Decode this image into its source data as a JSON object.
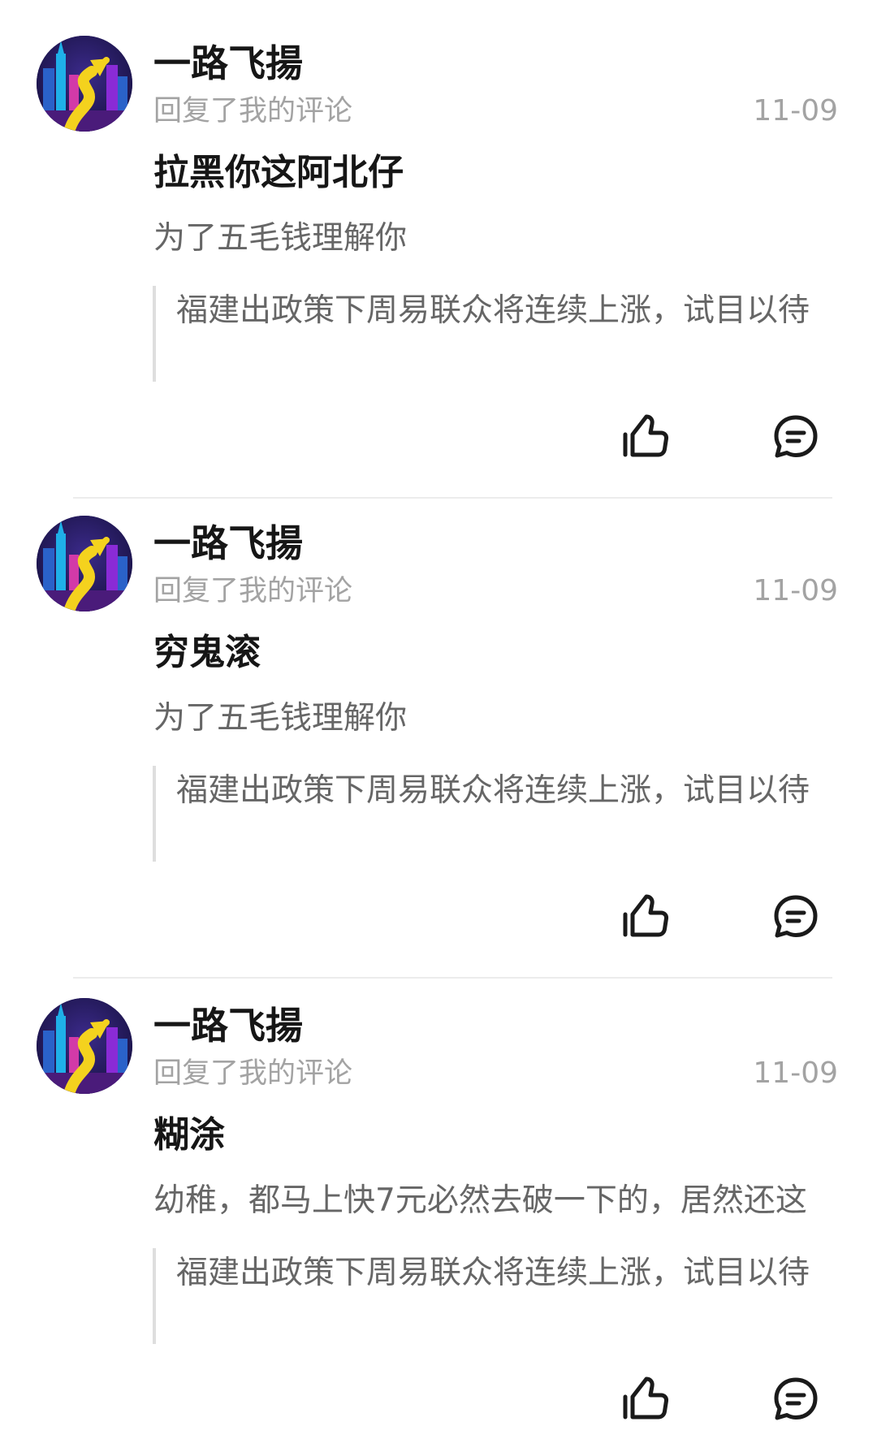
{
  "replies": [
    {
      "avatar": "avatar-city-arrow",
      "username": "一路飞揚",
      "action": "回复了我的评论",
      "date": "11-09",
      "reply_text": "拉黑你这阿北仔",
      "my_comment": "为了五毛钱理解你",
      "quoted": "福建出政策下周易联众将连续上涨，试目以待",
      "icons": {
        "like": "thumbs-up-icon",
        "comment": "comment-bubble-icon"
      }
    },
    {
      "avatar": "avatar-city-arrow",
      "username": "一路飞揚",
      "action": "回复了我的评论",
      "date": "11-09",
      "reply_text": "穷鬼滚",
      "my_comment": "为了五毛钱理解你",
      "quoted": "福建出政策下周易联众将连续上涨，试目以待",
      "icons": {
        "like": "thumbs-up-icon",
        "comment": "comment-bubble-icon"
      }
    },
    {
      "avatar": "avatar-city-arrow",
      "username": "一路飞揚",
      "action": "回复了我的评论",
      "date": "11-09",
      "reply_text": "糊涂",
      "my_comment": "幼稚，都马上快7元必然去破一下的，居然还这",
      "quoted": "福建出政策下周易联众将连续上涨，试目以待",
      "icons": {
        "like": "thumbs-up-icon",
        "comment": "comment-bubble-icon"
      }
    }
  ],
  "colors": {
    "primary_text": "#161616",
    "secondary_text": "#a3a3a3",
    "body_text": "#666666",
    "divider": "#ececec",
    "quote_bar": "#dedede"
  }
}
